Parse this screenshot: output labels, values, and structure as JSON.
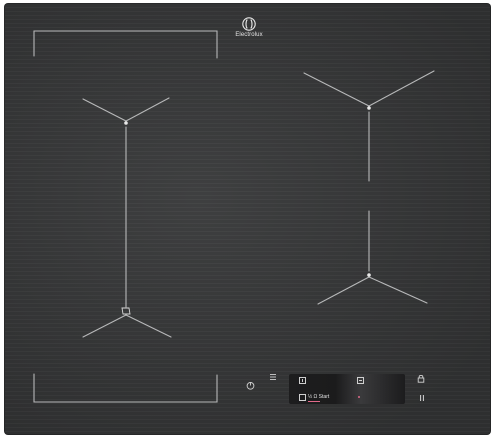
{
  "brand": {
    "name": "Electrolux"
  },
  "display": {
    "status_text": "½ Ω Start"
  },
  "icons": {
    "logo": "electrolux-logo-icon",
    "power": "power-icon",
    "menu": "menu-icon",
    "timer": "timer-icon",
    "function": "function-icon",
    "check": "checkbox-icon",
    "lock": "lock-icon",
    "pause": "pause-icon"
  },
  "colors": {
    "surface": "#343536",
    "lines": "#b9b9b9",
    "accent": "#e06a8a"
  }
}
